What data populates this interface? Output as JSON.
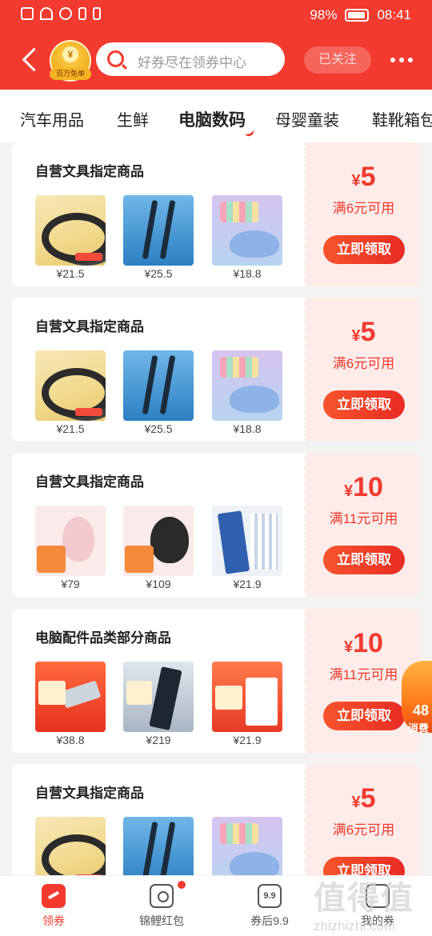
{
  "status_bar": {
    "battery": "98%",
    "time": "08:41"
  },
  "header": {
    "shop_badge": "百万免单",
    "search_placeholder": "好券尽在领券中心",
    "follow_label": "已关注"
  },
  "tabs": [
    "汽车用品",
    "生鲜",
    "电脑数码",
    "母婴童装",
    "鞋靴箱包"
  ],
  "active_tab": "电脑数码",
  "coupons": [
    {
      "title": "自营文具指定商品",
      "currency": "¥",
      "amount": "5",
      "condition": "满6元可用",
      "button": "立即领取",
      "products": [
        {
          "art": "tape",
          "price": "¥21.5"
        },
        {
          "art": "pen",
          "price": "¥25.5"
        },
        {
          "art": "correction-tape",
          "price": "¥18.8"
        }
      ]
    },
    {
      "title": "自营文具指定商品",
      "currency": "¥",
      "amount": "5",
      "condition": "满6元可用",
      "button": "立即领取",
      "products": [
        {
          "art": "tape",
          "price": "¥21.5"
        },
        {
          "art": "pen",
          "price": "¥25.5"
        },
        {
          "art": "correction-tape",
          "price": "¥18.8"
        }
      ]
    },
    {
      "title": "自营文具指定商品",
      "currency": "¥",
      "amount": "10",
      "condition": "满11元可用",
      "button": "立即领取",
      "products": [
        {
          "art": "mouse-pink",
          "price": "¥79"
        },
        {
          "art": "mouse-black",
          "price": "¥109"
        },
        {
          "art": "rocket-pens",
          "price": "¥21.9"
        }
      ]
    },
    {
      "title": "电脑配件品类部分商品",
      "currency": "¥",
      "amount": "10",
      "condition": "满11元可用",
      "button": "立即领取",
      "products": [
        {
          "art": "usb-drive",
          "price": "¥38.8"
        },
        {
          "art": "ssd",
          "price": "¥219"
        },
        {
          "art": "pens-box",
          "price": "¥21.9"
        }
      ]
    },
    {
      "title": "自营文具指定商品",
      "currency": "¥",
      "amount": "5",
      "condition": "满6元可用",
      "button": "立即领取",
      "products": [
        {
          "art": "tape",
          "price": ""
        },
        {
          "art": "pen",
          "price": ""
        },
        {
          "art": "correction-tape",
          "price": ""
        }
      ]
    }
  ],
  "float_badge": {
    "number": "48",
    "text": "消费"
  },
  "bottom_nav": [
    {
      "label": "领券",
      "icon": "coupon-icon"
    },
    {
      "label": "锦鲤红包",
      "icon": "red-envelope-icon"
    },
    {
      "label": "券后9.9",
      "icon": "nine-nine-icon",
      "icon_text": "9.9"
    },
    {
      "label": "我的券",
      "icon": "my-coupon-icon"
    }
  ],
  "watermark": {
    "mark": "值得值",
    "site": "zhizhizhi.com"
  },
  "colors": {
    "brand_red": "#f23a2f",
    "coupon_bg": "#fdecea"
  }
}
